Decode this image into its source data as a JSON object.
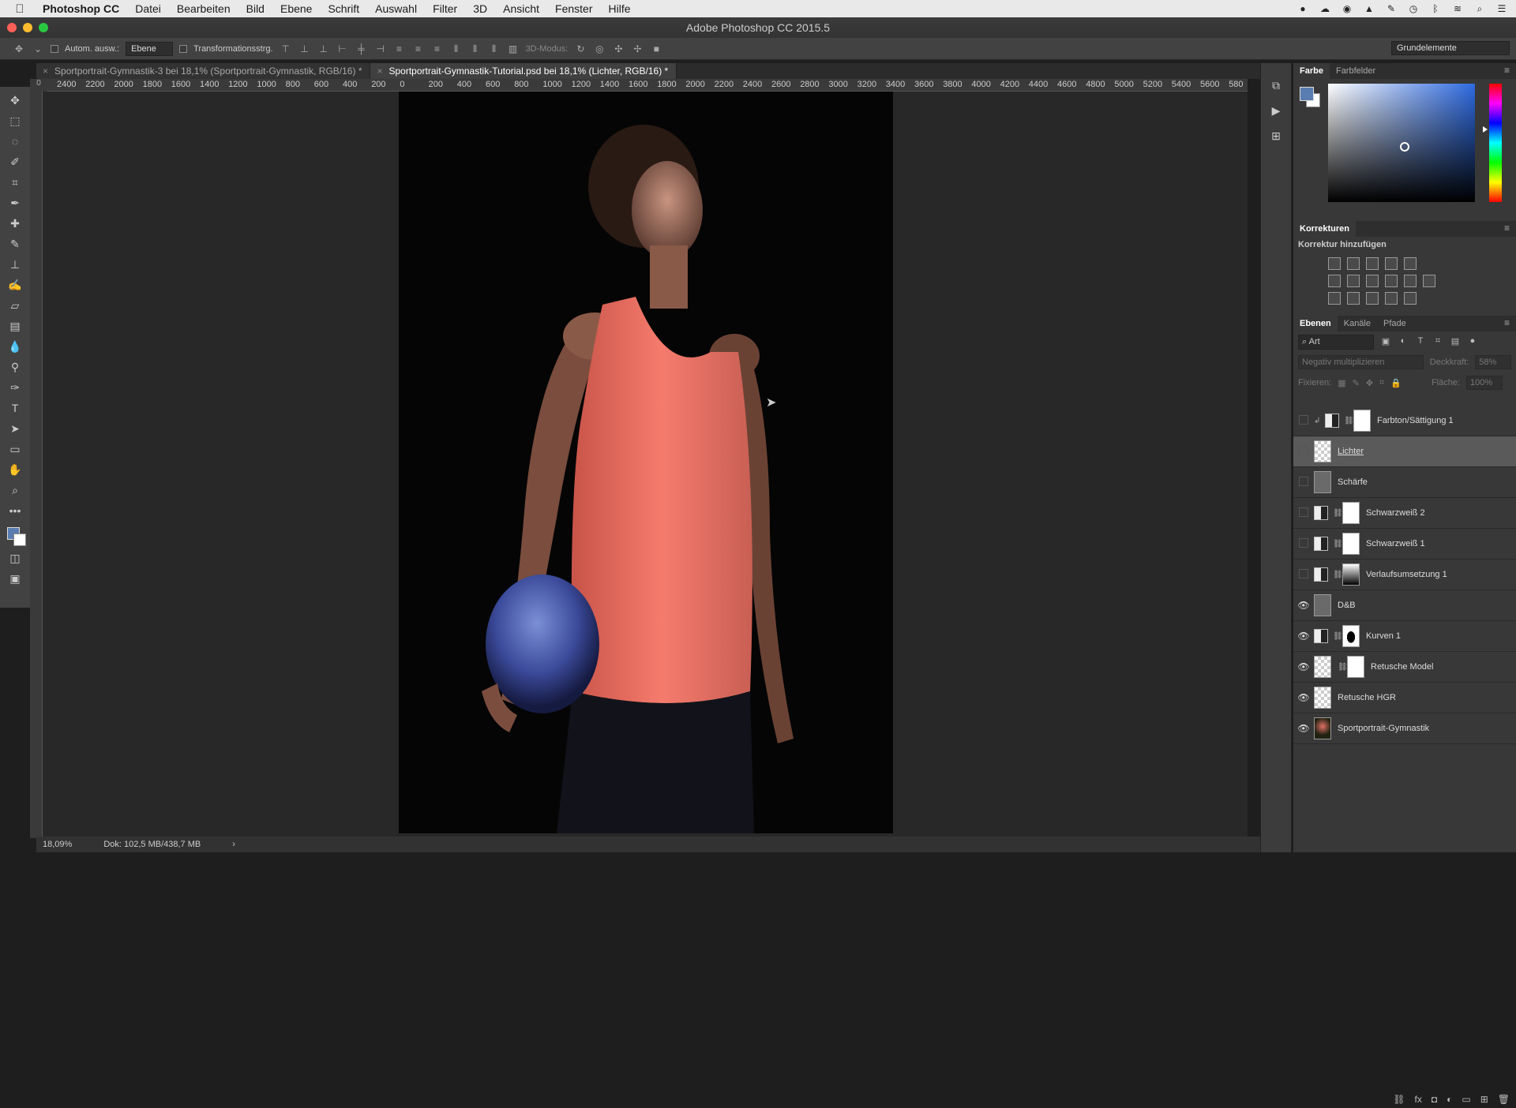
{
  "menubar": {
    "app": "Photoshop CC",
    "items": [
      "Datei",
      "Bearbeiten",
      "Bild",
      "Ebene",
      "Schrift",
      "Auswahl",
      "Filter",
      "3D",
      "Ansicht",
      "Fenster",
      "Hilfe"
    ]
  },
  "window": {
    "title": "Adobe Photoshop CC 2015.5"
  },
  "options": {
    "auto_select_label": "Autom. ausw.:",
    "auto_select_value": "Ebene",
    "transform_label": "Transformationsstrg.",
    "mode_3d": "3D-Modus:",
    "workspace": "Grundelemente"
  },
  "tabs": [
    {
      "label": "Sportportrait-Gymnastik-3 bei 18,1% (Sportportrait-Gymnastik, RGB/16) *",
      "active": false
    },
    {
      "label": "Sportportrait-Gymnastik-Tutorial.psd bei 18,1% (Lichter, RGB/16) *",
      "active": true
    }
  ],
  "ruler_h": [
    "2400",
    "2200",
    "2000",
    "1800",
    "1600",
    "1400",
    "1200",
    "1000",
    "800",
    "600",
    "400",
    "200",
    "0",
    "200",
    "400",
    "600",
    "800",
    "1000",
    "1200",
    "1400",
    "1600",
    "1800",
    "2000",
    "2200",
    "2400",
    "2600",
    "2800",
    "3000",
    "3200",
    "3400",
    "3600",
    "3800",
    "4000",
    "4200",
    "4400",
    "4600",
    "4800",
    "5000",
    "5200",
    "5400",
    "5600",
    "580"
  ],
  "status": {
    "zoom": "18,09%",
    "doc": "Dok: 102,5 MB/438,7 MB"
  },
  "color_panel": {
    "tabs": [
      "Farbe",
      "Farbfelder"
    ],
    "fg": "#5a7db1",
    "bg": "#ffffff"
  },
  "adjustments": {
    "title": "Korrekturen",
    "subtitle": "Korrektur hinzufügen"
  },
  "layers_panel": {
    "tabs": [
      "Ebenen",
      "Kanäle",
      "Pfade"
    ],
    "filter_label": "Art",
    "blend_mode": "Negativ multiplizieren",
    "opacity_label": "Deckkraft:",
    "opacity_value": "58%",
    "lock_label": "Fixieren:",
    "fill_label": "Fläche:",
    "fill_value": "100%",
    "layers": [
      {
        "name": "Farbton/Sättigung 1",
        "visible": false
      },
      {
        "name": "Lichter",
        "visible": false
      },
      {
        "name": "Schärfe",
        "visible": false
      },
      {
        "name": "Schwarzweiß 2",
        "visible": false
      },
      {
        "name": "Schwarzweiß 1",
        "visible": false
      },
      {
        "name": "Verlaufsumsetzung 1",
        "visible": false
      },
      {
        "name": "D&B",
        "visible": true
      },
      {
        "name": "Kurven 1",
        "visible": true
      },
      {
        "name": "Retusche Model",
        "visible": true
      },
      {
        "name": "Retusche HGR",
        "visible": true
      },
      {
        "name": "Sportportrait-Gymnastik",
        "visible": true
      }
    ]
  }
}
